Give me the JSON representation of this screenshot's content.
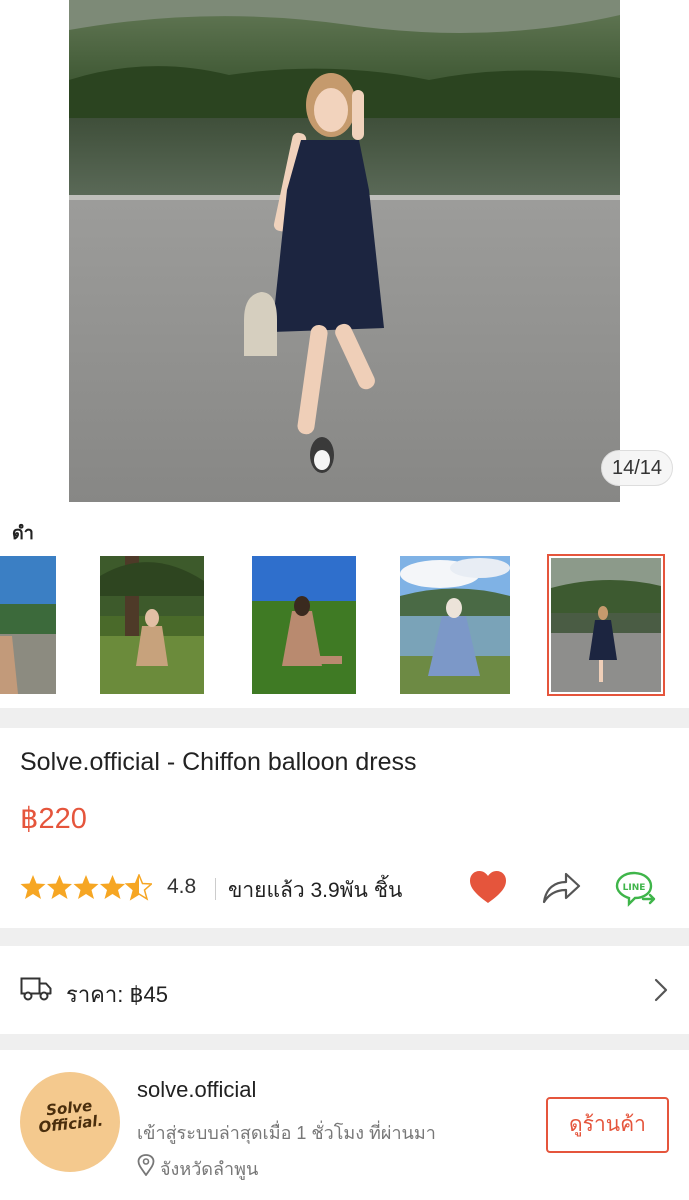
{
  "gallery": {
    "counter": "14/14",
    "variant_label": "ดำ"
  },
  "product": {
    "title": "Solve.official - Chiffon balloon dress",
    "price": "฿220",
    "rating": "4.8",
    "rating_stars": 4.5,
    "sold": "ขายแล้ว 3.9พัน ชิ้น"
  },
  "shipping": {
    "label": "ราคา: ฿45"
  },
  "shop": {
    "logo_text_line1": "Solve",
    "logo_text_line2": "Official.",
    "name": "solve.official",
    "last_active": "เข้าสู่ระบบล่าสุดเมื่อ 1 ชั่วโมง ที่ผ่านมา",
    "location": "จังหวัดลำพูน",
    "view_shop_label": "ดูร้านค้า"
  },
  "colors": {
    "accent": "#e5553c",
    "line_green": "#3fb54a",
    "star": "#f6a623"
  }
}
